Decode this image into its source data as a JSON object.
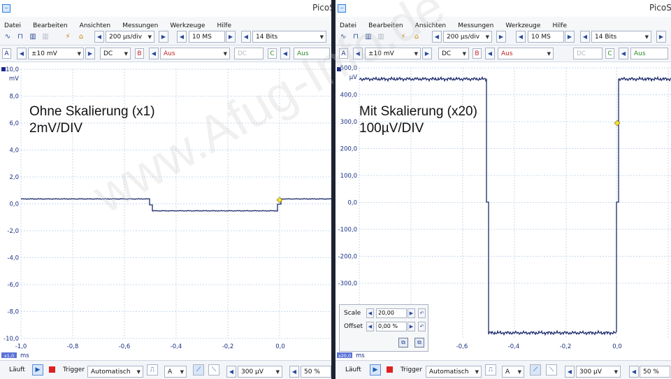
{
  "left": {
    "title": "PicoS",
    "menu": [
      "Datei",
      "Bearbeiten",
      "Ansichten",
      "Messungen",
      "Werkzeuge",
      "Hilfe"
    ],
    "timebase": "200 µs/div",
    "samples": "10 MS",
    "resolution": "14 Bits",
    "channel_a": {
      "letter": "A",
      "range": "±10 mV",
      "coupling": "DC"
    },
    "channel_b": {
      "letter": "B",
      "range": "Aus",
      "coupling": "DC"
    },
    "channel_c": {
      "letter": "C",
      "range": "Aus"
    },
    "y_axis": {
      "unit": "mV",
      "ticks": [
        "10,0",
        "8,0",
        "6,0",
        "4,0",
        "2,0",
        "0,0",
        "-2,0",
        "-4,0",
        "-6,0",
        "-8,0",
        "-10,0"
      ]
    },
    "x_axis": {
      "unit": "ms",
      "ticks": [
        "-1,0",
        "-0,8",
        "-0,6",
        "-0,4",
        "-0,2",
        "0,0"
      ],
      "badge": "x1,0"
    },
    "annotation": [
      "Ohne Skalierung (x1)",
      "2mV/DIV"
    ],
    "status": {
      "run": "Läuft",
      "trigger_label": "Trigger",
      "trigger_mode": "Automatisch",
      "trigger_channel": "A",
      "threshold": "300 µV",
      "pretrigger": "50 %"
    }
  },
  "right": {
    "title": "PicoSc",
    "menu": [
      "Datei",
      "Bearbeiten",
      "Ansichten",
      "Messungen",
      "Werkzeuge",
      "Hilfe"
    ],
    "timebase": "200 µs/div",
    "samples": "10 MS",
    "resolution": "14 Bits",
    "channel_a": {
      "letter": "A",
      "range": "±10 mV",
      "coupling": "DC"
    },
    "channel_b": {
      "letter": "B",
      "range": "Aus",
      "coupling": "DC"
    },
    "channel_c": {
      "letter": "C",
      "range": "Aus"
    },
    "y_axis": {
      "unit": "µV",
      "ticks": [
        "500,0",
        "400,0",
        "300,0",
        "200,0",
        "100,0",
        "0,0",
        "-100,0",
        "-200,0",
        "-300,0"
      ]
    },
    "x_axis": {
      "unit": "ms",
      "ticks": [
        "-0,6",
        "-0,4",
        "-0,2",
        "0,0"
      ],
      "badge": "x20,0"
    },
    "annotation": [
      "Mit Skalierung (x20)",
      "100µV/DIV"
    ],
    "scale_panel": {
      "scale_label": "Scale",
      "scale_value": "20,00",
      "offset_label": "Offset",
      "offset_value": "0,00 %"
    },
    "status": {
      "run": "Läuft",
      "trigger_label": "Trigger",
      "trigger_mode": "Automatisch",
      "trigger_channel": "A",
      "threshold": "300 µV",
      "pretrigger": "50 %"
    }
  },
  "colors": {
    "trace": "#1b2a6b",
    "grid": "#c9d9ea",
    "trigger_marker": "#f2e23a",
    "axis_text": "#1a2f86",
    "watermark": "#c8c8c8"
  },
  "watermark": "www.Afug-Info.de"
}
